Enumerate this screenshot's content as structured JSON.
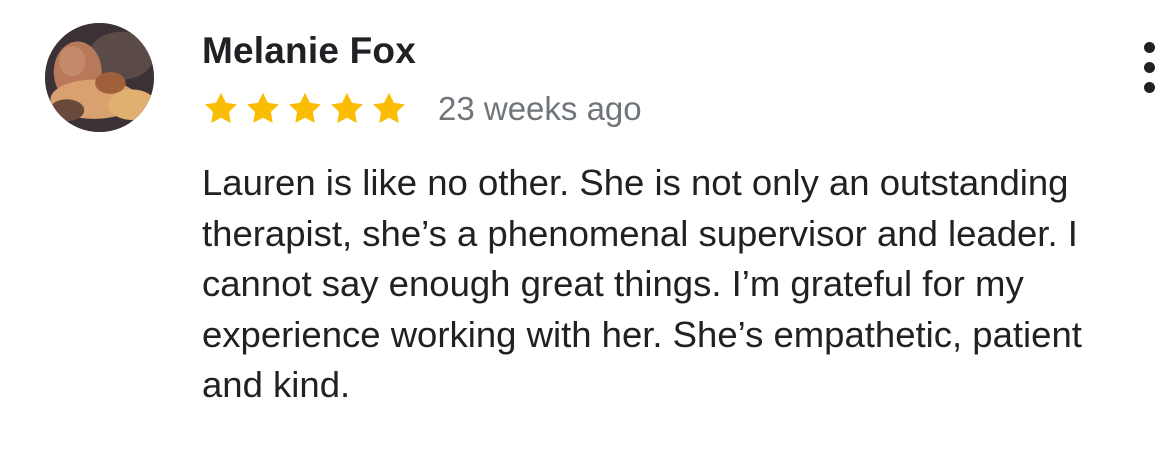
{
  "review": {
    "reviewer_name": "Melanie Fox",
    "rating": 5,
    "rating_max": 5,
    "star_color": "#FBBC04",
    "time": "23 weeks ago",
    "text": "Lauren is like no other. She is not only an outstanding therapist, she’s a phenomenal supervisor and leader. I cannot say enough great things. I’m grateful for my experience working with her. She’s empathetic, patient and kind.",
    "avatar_icon": "profile-photo",
    "menu_icon": "more-vertical-icon"
  },
  "colors": {
    "name": "#202124",
    "meta": "#70757a",
    "body": "#202124"
  }
}
